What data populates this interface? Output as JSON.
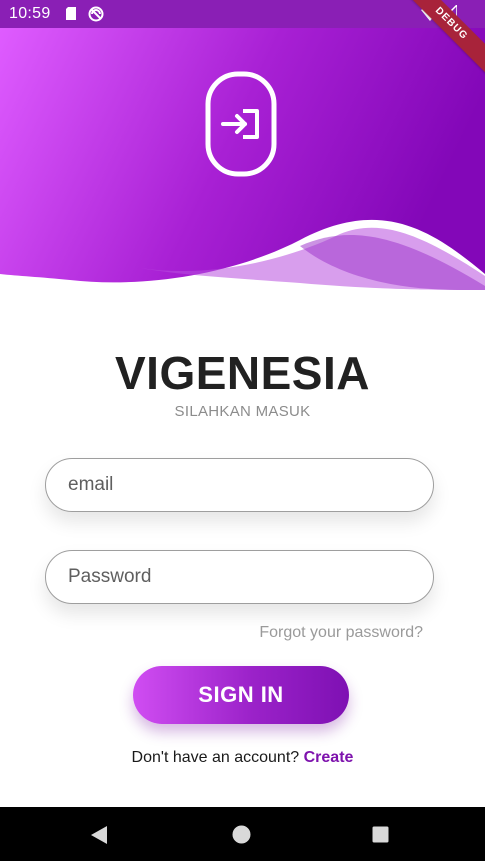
{
  "status_bar": {
    "time": "10:59",
    "icons": [
      "sd-card-icon",
      "do-not-disturb-icon",
      "wifi-icon",
      "signal-icon"
    ]
  },
  "debug_banner": "DEBUG",
  "header": {
    "icon": "login-icon",
    "colors": {
      "gradient_start": "#df5cff",
      "gradient_end": "#8307b8"
    }
  },
  "app": {
    "title": "VIGENESIA",
    "subtitle": "SILAHKAN MASUK"
  },
  "form": {
    "email_placeholder": "email",
    "password_placeholder": "Password",
    "forgot_label": "Forgot your password?",
    "signin_label": "SIGN IN",
    "signup_prompt": "Don't have an account?",
    "signup_link": "Create"
  },
  "nav_bar": {
    "icons": [
      "back-icon",
      "home-icon",
      "recents-icon"
    ]
  }
}
